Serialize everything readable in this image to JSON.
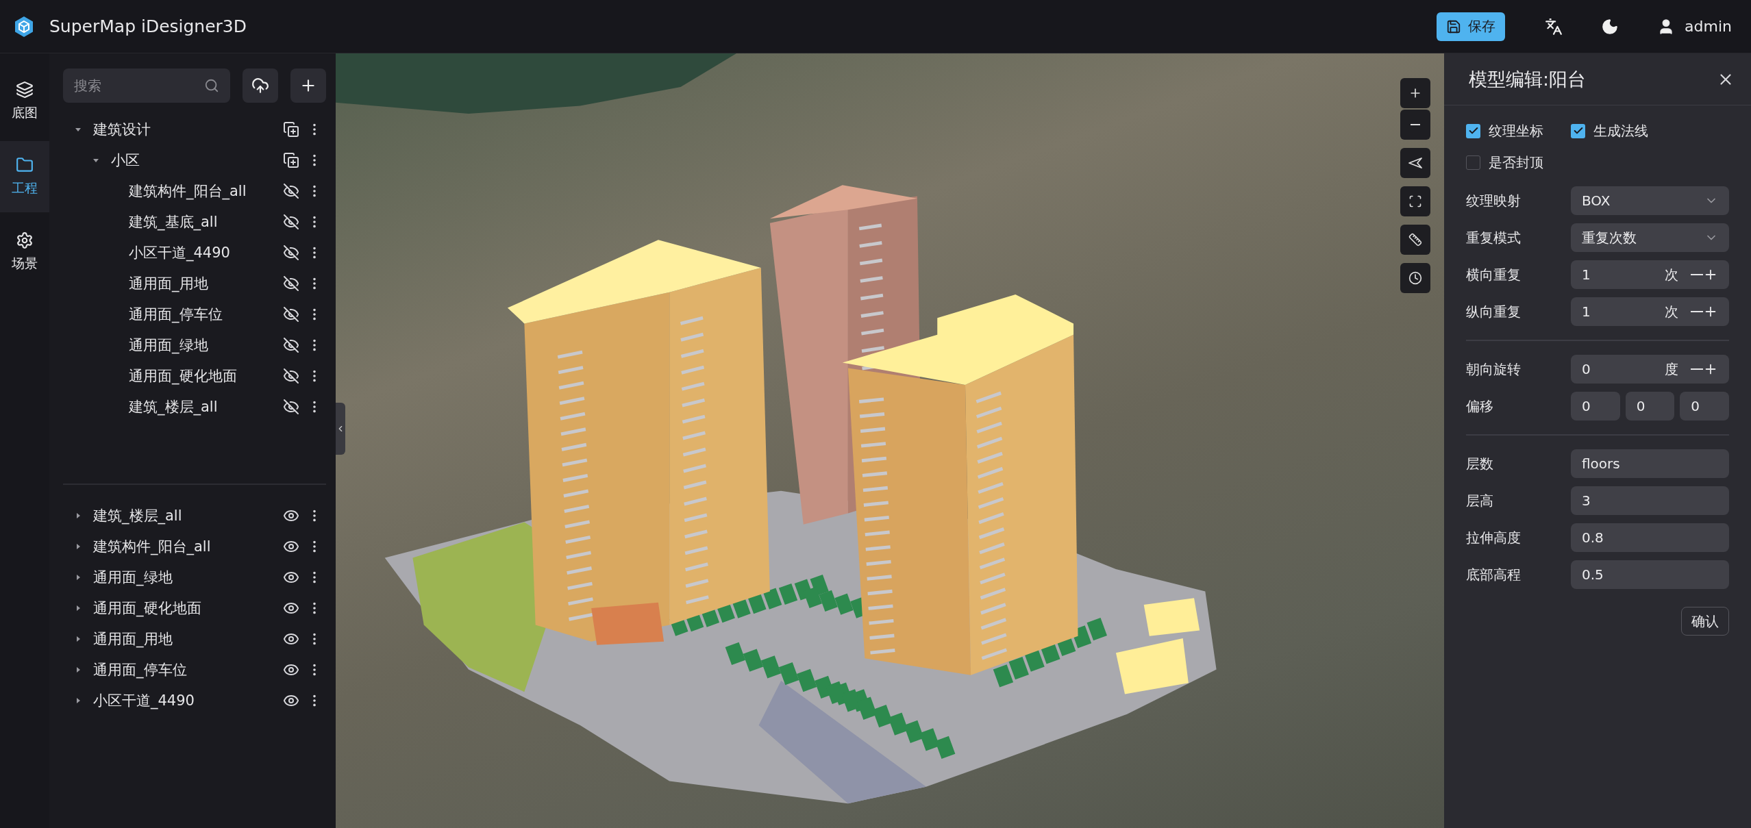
{
  "header": {
    "title": "SuperMap iDesigner3D",
    "save_label": "保存",
    "user": "admin"
  },
  "nav": [
    {
      "label": "底图",
      "selected": false
    },
    {
      "label": "工程",
      "selected": true
    },
    {
      "label": "场景",
      "selected": false
    }
  ],
  "search": {
    "placeholder": "搜索"
  },
  "tree": [
    {
      "label": "建筑设计",
      "kind": "group",
      "expanded": true,
      "children": [
        {
          "label": "小区",
          "kind": "group",
          "expanded": true,
          "children": [
            {
              "label": "建筑构件_阳台_all",
              "kind": "layer",
              "visible": false
            },
            {
              "label": "建筑_基底_all",
              "kind": "layer",
              "visible": false
            },
            {
              "label": "小区干道_4490",
              "kind": "layer",
              "visible": false
            },
            {
              "label": "通用面_用地",
              "kind": "layer",
              "visible": false
            },
            {
              "label": "通用面_停车位",
              "kind": "layer",
              "visible": false
            },
            {
              "label": "通用面_绿地",
              "kind": "layer",
              "visible": false
            },
            {
              "label": "通用面_硬化地面",
              "kind": "layer",
              "visible": false
            },
            {
              "label": "建筑_楼层_all",
              "kind": "layer",
              "visible": false
            }
          ]
        }
      ]
    }
  ],
  "layers": [
    {
      "label": "建筑_楼层_all",
      "expanded": false,
      "visible": true
    },
    {
      "label": "建筑构件_阳台_all",
      "expanded": false,
      "visible": true
    },
    {
      "label": "通用面_绿地",
      "expanded": false,
      "visible": true
    },
    {
      "label": "通用面_硬化地面",
      "expanded": false,
      "visible": true
    },
    {
      "label": "通用面_用地",
      "expanded": false,
      "visible": true
    },
    {
      "label": "通用面_停车位",
      "expanded": false,
      "visible": true
    },
    {
      "label": "小区干道_4490",
      "expanded": false,
      "visible": true
    }
  ],
  "panel": {
    "title": "模型编辑:阳台",
    "checkbox_rows": [
      [
        {
          "label": "纹理坐标",
          "checked": true
        },
        {
          "label": "生成法线",
          "checked": true
        }
      ],
      [
        {
          "label": "是否封顶",
          "checked": false
        }
      ]
    ],
    "sections": [
      [
        {
          "kind": "select",
          "label": "纹理映射",
          "value": "BOX"
        },
        {
          "kind": "select",
          "label": "重复模式",
          "value": "重复次数"
        },
        {
          "kind": "stepper",
          "label": "横向重复",
          "value": "1",
          "unit": "次"
        },
        {
          "kind": "stepper",
          "label": "纵向重复",
          "value": "1",
          "unit": "次"
        }
      ],
      [
        {
          "kind": "stepper",
          "label": "朝向旋转",
          "value": "0",
          "unit": "度"
        },
        {
          "kind": "triple",
          "label": "偏移",
          "values": [
            "0",
            "0",
            "0"
          ]
        }
      ],
      [
        {
          "kind": "text",
          "label": "层数",
          "value": "floors"
        },
        {
          "kind": "text",
          "label": "层高",
          "value": "3"
        },
        {
          "kind": "text",
          "label": "拉伸高度",
          "value": "0.8"
        },
        {
          "kind": "text",
          "label": "底部高程",
          "value": "0.5"
        }
      ]
    ],
    "confirm_label": "确认"
  }
}
